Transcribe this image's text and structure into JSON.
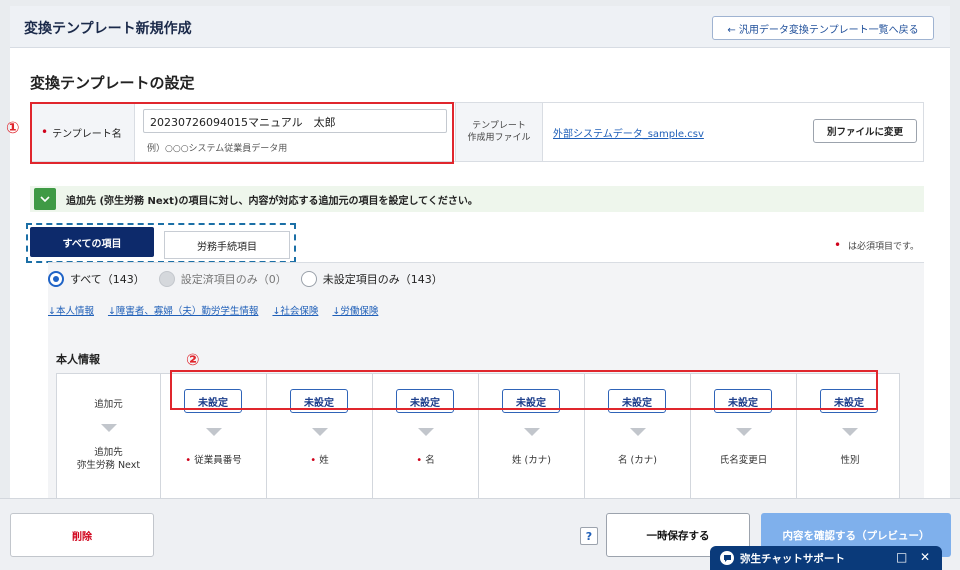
{
  "header": {
    "title": "変換テンプレート新規作成",
    "back_button": "← 汎用データ変換テンプレート一覧へ戻る"
  },
  "settings": {
    "section_title": "変換テンプレートの設定",
    "template_name_label": "テンプレート名",
    "template_name_value": "20230726094015マニュアル　太郎",
    "template_name_hint": "例）○○○システム従業員データ用",
    "file_label_line1": "テンプレート",
    "file_label_line2": "作成用ファイル",
    "file_link": "外部システムデータ_sample.csv",
    "change_file_button": "別ファイルに変更"
  },
  "annotations": {
    "badge1": "①",
    "badge2": "②"
  },
  "info": {
    "text": "追加先 (弥生労務 Next)の項目に対し、内容が対応する追加元の項目を設定してください。"
  },
  "tabs": {
    "all": "すべての項目",
    "labor": "労務手続項目"
  },
  "required_note": "は必須項目です。",
  "filters": {
    "all": "すべて（143）",
    "configured": "設定済項目のみ（0）",
    "unconfigured": "未設定項目のみ（143）"
  },
  "anchors": [
    "↓本人情報",
    "↓障害者、寡婦（夫）勤労学生情報",
    "↓社会保険",
    "↓労働保険"
  ],
  "group": {
    "title": "本人情報",
    "source_label": "追加元",
    "dest_label_line1": "追加先",
    "dest_label_line2": "弥生労務 Next",
    "unset_label": "未設定",
    "fields": [
      {
        "name": "従業員番号",
        "required": true
      },
      {
        "name": "姓",
        "required": true
      },
      {
        "name": "名",
        "required": true
      },
      {
        "name": "姓 (カナ)",
        "required": false
      },
      {
        "name": "名 (カナ)",
        "required": false
      },
      {
        "name": "氏名変更日",
        "required": false
      },
      {
        "name": "性別",
        "required": false
      }
    ]
  },
  "footer": {
    "delete": "削除",
    "help": "?",
    "save": "一時保存する",
    "preview": "内容を確認する（プレビュー）"
  },
  "chat": {
    "title": "弥生チャットサポート",
    "minimize": "□",
    "close": "✕"
  },
  "colors": {
    "primary_navy": "#0d2a6b",
    "annotation_red": "#e0262d",
    "link_blue": "#1f5fb8",
    "preview_button": "#7fb0ec",
    "info_green": "#3f9a45"
  }
}
